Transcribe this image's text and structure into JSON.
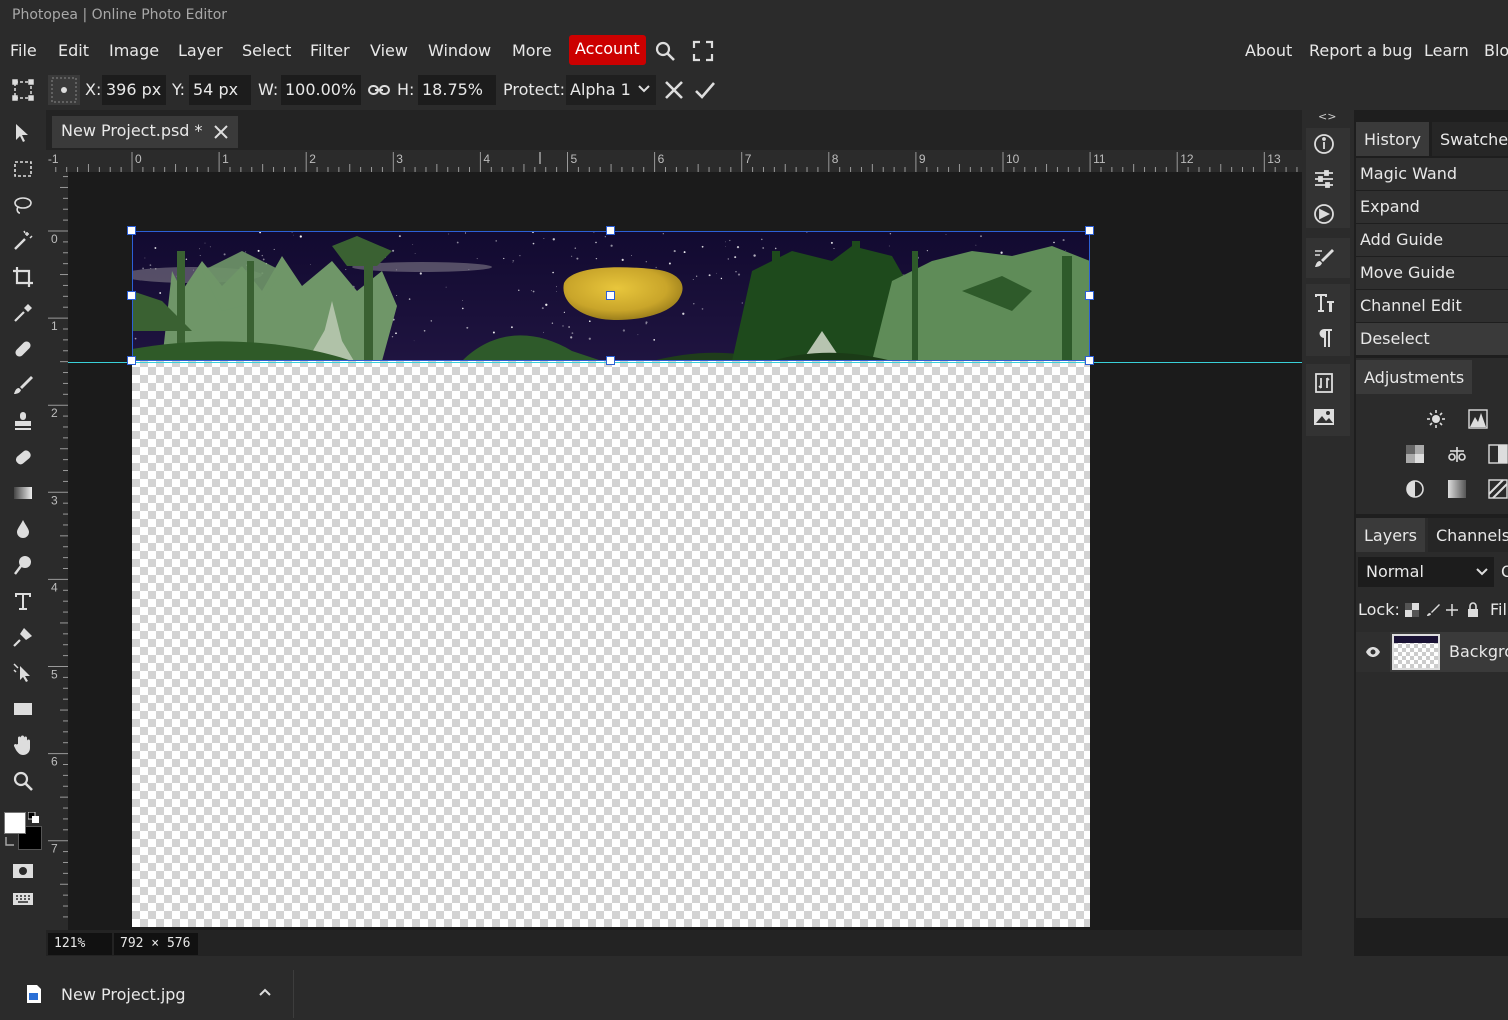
{
  "window": {
    "title": "Photopea | Online Photo Editor"
  },
  "menubar": {
    "left_items": [
      "File",
      "Edit",
      "Image",
      "Layer",
      "Select",
      "Filter",
      "View",
      "Window",
      "More"
    ],
    "account_label": "Account",
    "right_items": [
      "About",
      "Report a bug",
      "Learn",
      "Blo"
    ]
  },
  "options": {
    "x_label": "X:",
    "x_value": "396 px",
    "y_label": "Y:",
    "y_value": "54 px",
    "w_label": "W:",
    "w_value": "100.00%",
    "h_label": "H:",
    "h_value": "18.75%",
    "protect_label": "Protect:",
    "protect_value": "Alpha 1"
  },
  "document": {
    "tab_title": "New Project.psd *",
    "zoom": "121%",
    "dimensions": "792 × 576"
  },
  "rulers": {
    "horizontal": [
      "-1",
      "0",
      "1",
      "2",
      "3",
      "4",
      "5",
      "6",
      "7",
      "8",
      "9",
      "10",
      "11",
      "12",
      "13"
    ],
    "vertical": [
      "0",
      "1",
      "2",
      "3",
      "4",
      "5",
      "6",
      "7"
    ]
  },
  "panels": {
    "top_tabs": [
      "History",
      "Swatches"
    ],
    "history": [
      "Magic Wand",
      "Expand",
      "Add Guide",
      "Move Guide",
      "Channel Edit",
      "Deselect"
    ],
    "adjustments_title": "Adjustments",
    "layer_tabs": [
      "Layers",
      "Channels"
    ],
    "blend_mode": "Normal",
    "opacity_cut": "O",
    "lock_label": "Lock:",
    "fill_label": "Fil",
    "layers": [
      {
        "name": "Backgro"
      }
    ],
    "collapse_glyph": "<>"
  },
  "taskbar": {
    "file_name": "New Project.jpg"
  },
  "colors": {
    "accent": "#cc0000",
    "selection": "#2c5fd6",
    "guide": "#3ad0d8"
  }
}
